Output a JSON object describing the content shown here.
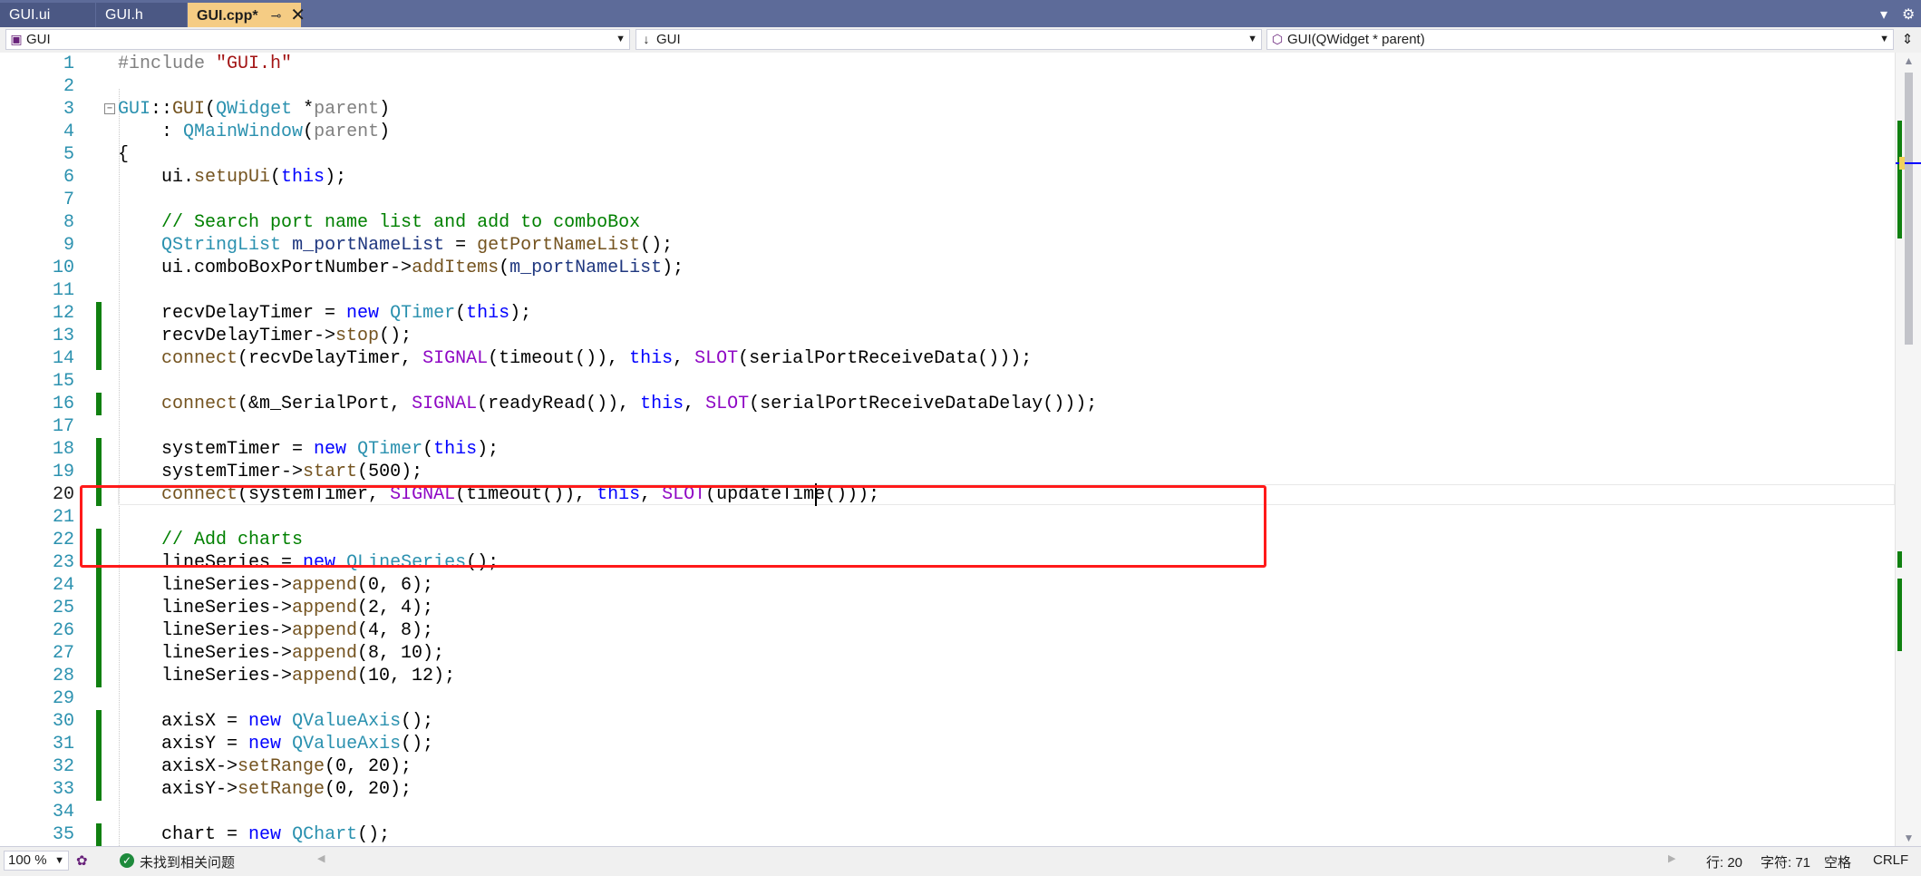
{
  "tabs": [
    {
      "label": "GUI.ui",
      "active": false
    },
    {
      "label": "GUI.h",
      "active": false
    },
    {
      "label": "GUI.cpp*",
      "active": true
    }
  ],
  "tab_icons": {
    "pin": "⊸",
    "close": "✕",
    "dropdown": "▾",
    "settings": "⚙"
  },
  "nav": {
    "project": "GUI",
    "scope": "GUI",
    "member": "GUI(QWidget * parent)"
  },
  "code_lines": [
    {
      "n": "1",
      "html": "<span class=\"pp\">#include</span> <span class=\"st\">\"GUI.h\"</span>"
    },
    {
      "n": "2",
      "html": ""
    },
    {
      "n": "3",
      "html": "<span class=\"ty\">GUI</span>::<span class=\"fn\">GUI</span>(<span class=\"ty\">QWidget</span> *<span class=\"pp\">parent</span>)"
    },
    {
      "n": "4",
      "html": "    : <span class=\"ty\">QMainWindow</span>(<span class=\"pp\">parent</span>)"
    },
    {
      "n": "5",
      "html": "{"
    },
    {
      "n": "6",
      "html": "    ui.<span class=\"fn\">setupUi</span>(<span class=\"kw\">this</span>);"
    },
    {
      "n": "7",
      "html": ""
    },
    {
      "n": "8",
      "html": "    <span class=\"cm\">// Search port name list and add to comboBox</span>"
    },
    {
      "n": "9",
      "html": "    <span class=\"ty\">QStringList</span> <span class=\"mem\">m_portNameList</span> = <span class=\"fn\">getPortNameList</span>();"
    },
    {
      "n": "10",
      "html": "    ui.comboBoxPortNumber-><span class=\"fn\">addItems</span>(<span class=\"mem\">m_portNameList</span>);"
    },
    {
      "n": "11",
      "html": ""
    },
    {
      "n": "12",
      "html": "    recvDelayTimer = <span class=\"kw\">new</span> <span class=\"ty\">QTimer</span>(<span class=\"kw\">this</span>);"
    },
    {
      "n": "13",
      "html": "    recvDelayTimer-><span class=\"fn\">stop</span>();"
    },
    {
      "n": "14",
      "html": "    <span class=\"fn\">connect</span>(recvDelayTimer, <span class=\"mac\">SIGNAL</span>(timeout()), <span class=\"kw\">this</span>, <span class=\"mac\">SLOT</span>(serialPortReceiveData()));"
    },
    {
      "n": "15",
      "html": ""
    },
    {
      "n": "16",
      "html": "    <span class=\"fn\">connect</span>(&amp;m_SerialPort, <span class=\"mac\">SIGNAL</span>(readyRead()), <span class=\"kw\">this</span>, <span class=\"mac\">SLOT</span>(serialPortReceiveDataDelay()));"
    },
    {
      "n": "17",
      "html": ""
    },
    {
      "n": "18",
      "html": "    systemTimer = <span class=\"kw\">new</span> <span class=\"ty\">QTimer</span>(<span class=\"kw\">this</span>);"
    },
    {
      "n": "19",
      "html": "    systemTimer-><span class=\"fn\">start</span>(500);"
    },
    {
      "n": "20",
      "html": "    <span class=\"fn\">connect</span>(systemTimer, <span class=\"mac\">SIGNAL</span>(timeout()), <span class=\"kw\">this</span>, <span class=\"mac\">SLOT</span>(updateTime()));"
    },
    {
      "n": "21",
      "html": ""
    },
    {
      "n": "22",
      "html": "    <span class=\"cm\">// Add charts</span>"
    },
    {
      "n": "23",
      "html": "    lineSeries = <span class=\"kw\">new</span> <span class=\"ty\">QLineSeries</span>();"
    },
    {
      "n": "24",
      "html": "    lineSeries-><span class=\"fn\">append</span>(0, 6);"
    },
    {
      "n": "25",
      "html": "    lineSeries-><span class=\"fn\">append</span>(2, 4);"
    },
    {
      "n": "26",
      "html": "    lineSeries-><span class=\"fn\">append</span>(4, 8);"
    },
    {
      "n": "27",
      "html": "    lineSeries-><span class=\"fn\">append</span>(8, 10);"
    },
    {
      "n": "28",
      "html": "    lineSeries-><span class=\"fn\">append</span>(10, 12);"
    },
    {
      "n": "29",
      "html": ""
    },
    {
      "n": "30",
      "html": "    axisX = <span class=\"kw\">new</span> <span class=\"ty\">QValueAxis</span>();"
    },
    {
      "n": "31",
      "html": "    axisY = <span class=\"kw\">new</span> <span class=\"ty\">QValueAxis</span>();"
    },
    {
      "n": "32",
      "html": "    axisX-><span class=\"fn\">setRange</span>(0, 20);"
    },
    {
      "n": "33",
      "html": "    axisY-><span class=\"fn\">setRange</span>(0, 20);"
    },
    {
      "n": "34",
      "html": ""
    },
    {
      "n": "35",
      "html": "    chart = <span class=\"kw\">new</span> <span class=\"ty\">QChart</span>();"
    }
  ],
  "current_line": "20",
  "changed_lines": [
    "12",
    "13",
    "14",
    "16",
    "18",
    "19",
    "20",
    "22",
    "23",
    "24",
    "25",
    "26",
    "27",
    "28",
    "30",
    "31",
    "32",
    "33",
    "35"
  ],
  "status": {
    "zoom": "100 %",
    "issues": "未找到相关问题",
    "position": "行: 20",
    "chars": "字符: 71",
    "ws": "空格",
    "eol": "CRLF"
  },
  "colors": {
    "tab_active": "#f5cc84",
    "tabbar": "#5d6b99",
    "change_marker": "#108010",
    "highlight_box": "#ff1a1a"
  }
}
